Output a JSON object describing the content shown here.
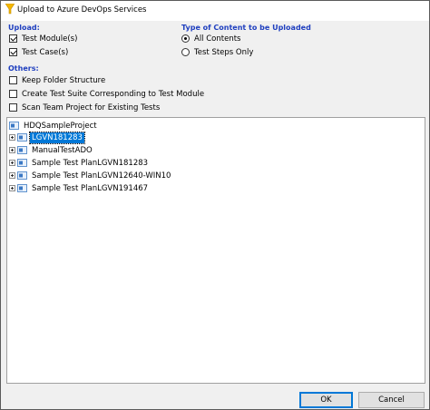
{
  "window": {
    "title": "Upload to Azure DevOps Services"
  },
  "upload": {
    "heading": "Upload:",
    "options": [
      {
        "label": "Test Module(s)",
        "checked": true
      },
      {
        "label": "Test Case(s)",
        "checked": true
      }
    ]
  },
  "content_type": {
    "heading": "Type of Content to be Uploaded",
    "options": [
      {
        "label": "All Contents",
        "selected": true
      },
      {
        "label": "Test Steps Only",
        "selected": false
      }
    ]
  },
  "others": {
    "heading": "Others:",
    "options": [
      {
        "label": "Keep Folder Structure",
        "checked": false
      },
      {
        "label": "Create Test Suite Corresponding to Test Module",
        "checked": false
      },
      {
        "label": "Scan Team Project for Existing Tests",
        "checked": false
      }
    ]
  },
  "tree": {
    "root": "HDQSampleProject",
    "nodes": [
      {
        "label": "LGVN181283",
        "selected": true
      },
      {
        "label": "ManualTestADO",
        "selected": false
      },
      {
        "label": "Sample Test PlanLGVN181283",
        "selected": false
      },
      {
        "label": "Sample Test PlanLGVN12640-WIN10",
        "selected": false
      },
      {
        "label": "Sample Test PlanLGVN191467",
        "selected": false
      }
    ]
  },
  "buttons": {
    "ok": "OK",
    "cancel": "Cancel"
  },
  "colors": {
    "section_heading": "#1f3fbf",
    "selection": "#0078d7",
    "window_bg": "#f0f0f0"
  }
}
